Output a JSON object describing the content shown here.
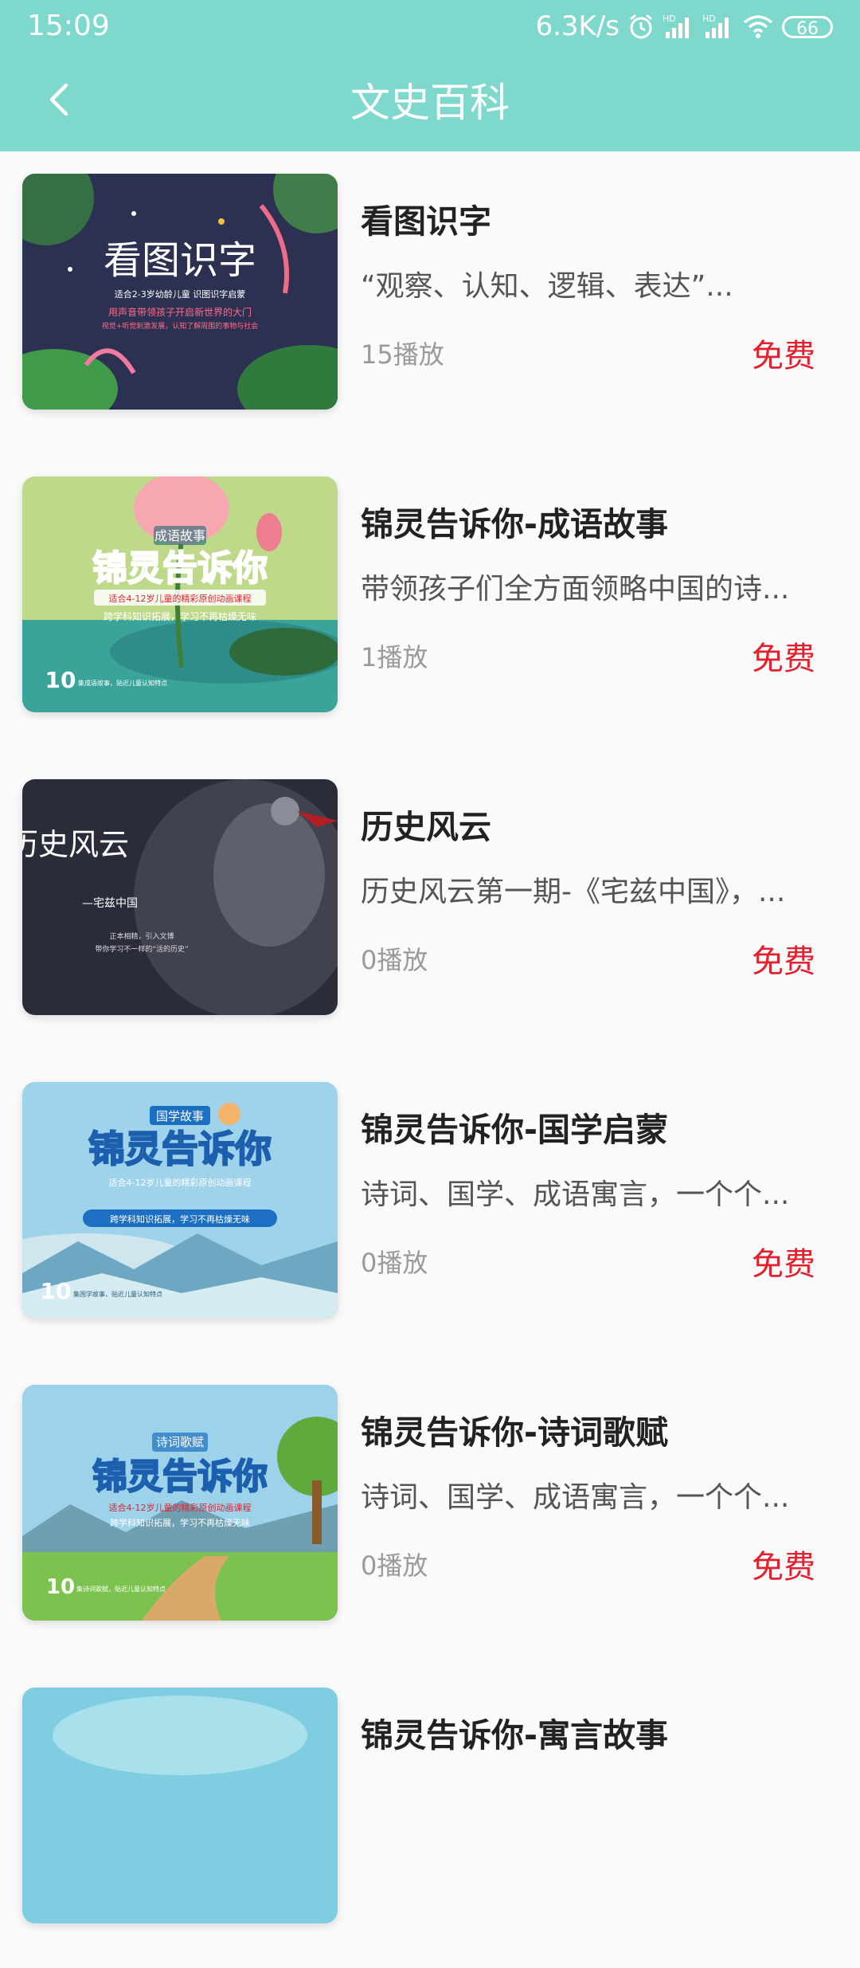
{
  "status_bar": {
    "time": "15:09",
    "net_speed": "6.3K/s",
    "battery": "66",
    "icons": [
      "alarm-icon",
      "signal-hd-icon",
      "signal-hd-icon",
      "wifi-icon",
      "battery-icon"
    ]
  },
  "header": {
    "title": "文史百科",
    "back_icon": "chevron-left-icon",
    "background": "#7fd8cc"
  },
  "courses": [
    {
      "title": "看图识字",
      "description": "“观察、认知、逻辑、表达”...",
      "plays": "15播放",
      "price": "免费",
      "thumbnail": {
        "headline": "看图识字",
        "subline": "适合2-3岁幼龄儿童 识图识字启蒙",
        "line2": "用声音带领孩子开启新世界的大门",
        "line3": "视觉+听觉刺激发展，认知了解周围的事物与社会"
      }
    },
    {
      "title": "锦灵告诉你-成语故事",
      "description": "带领孩子们全方面领略中国的诗...",
      "plays": "1播放",
      "price": "免费",
      "thumbnail": {
        "tag": "成语故事",
        "headline": "锦灵告诉你",
        "subline": "适合4-12岁儿童的精彩原创动画课程",
        "line2": "跨学科知识拓展，学习不再枯燥无味",
        "count": "10",
        "count_note": "集成语故事，贴近儿童认知特点"
      }
    },
    {
      "title": "历史风云",
      "description": "历史风云第一期-《宅兹中国》，...",
      "plays": "0播放",
      "price": "免费",
      "thumbnail": {
        "headline": "历史风云",
        "subline": "—宅兹中国",
        "line2": "正本相精，引入文博",
        "line3": "带你学习不一样的“活的历史”"
      }
    },
    {
      "title": "锦灵告诉你-国学启蒙",
      "description": "诗词、国学、成语寓言，一个个...",
      "plays": "0播放",
      "price": "免费",
      "thumbnail": {
        "tag": "国学故事",
        "headline": "锦灵告诉你",
        "subline": "适合4-12岁儿童的精彩原创动画课程",
        "line2": "跨学科知识拓展，学习不再枯燥无味",
        "count": "10",
        "count_note": "集国学故事，贴近儿童认知特点"
      }
    },
    {
      "title": "锦灵告诉你-诗词歌赋",
      "description": "诗词、国学、成语寓言，一个个...",
      "plays": "0播放",
      "price": "免费",
      "thumbnail": {
        "tag": "诗词歌赋",
        "headline": "锦灵告诉你",
        "subline": "适合4-12岁儿童的精彩原创动画课程",
        "line2": "跨学科知识拓展，学习不再枯燥无味",
        "count": "10",
        "count_note": "集诗词歌赋，贴近儿童认知特点"
      }
    },
    {
      "title": "锦灵告诉你-寓言故事",
      "description": "",
      "plays": "",
      "price": ""
    }
  ],
  "colors": {
    "accent": "#7fd8cc",
    "price": "#e4202e",
    "title_text": "#222222",
    "meta_text": "#9a9a9a"
  }
}
